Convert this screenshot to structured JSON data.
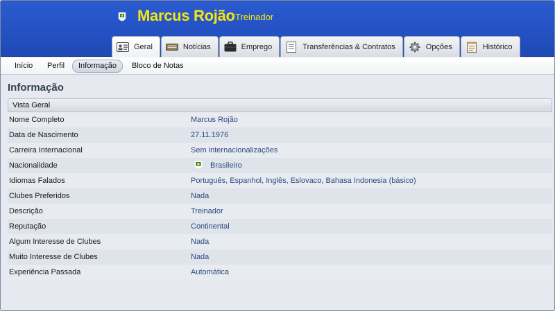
{
  "header": {
    "name": "Marcus Rojão",
    "role": "Treinador"
  },
  "tabs": [
    {
      "label": "Geral",
      "icon": "id-card-icon",
      "active": true
    },
    {
      "label": "Notícias",
      "icon": "newspaper-icon",
      "active": false
    },
    {
      "label": "Emprego",
      "icon": "briefcase-icon",
      "active": false
    },
    {
      "label": "Transferências & Contratos",
      "icon": "document-icon",
      "active": false
    },
    {
      "label": "Opções",
      "icon": "gear-icon",
      "active": false
    },
    {
      "label": "Histórico",
      "icon": "notepad-icon",
      "active": false
    }
  ],
  "subnav": [
    {
      "label": "Início",
      "active": false
    },
    {
      "label": "Perfil",
      "active": false
    },
    {
      "label": "Informação",
      "active": true
    },
    {
      "label": "Bloco de Notas",
      "active": false
    }
  ],
  "section": {
    "title": "Informação",
    "panel_title": "Vista Geral"
  },
  "info": [
    {
      "key": "Nome Completo",
      "value": "Marcus Rojão"
    },
    {
      "key": "Data de Nascimento",
      "value": "27.11.1976"
    },
    {
      "key": "Carreira Internacional",
      "value": "Sem internacionalizações"
    },
    {
      "key": "Nacionalidade",
      "value": "Brasileiro",
      "icon": "brazil-crest-icon"
    },
    {
      "key": "Idiomas Falados",
      "value": "Português, Espanhol, Inglês, Eslovaco, Bahasa Indonesia (básico)"
    },
    {
      "key": "Clubes Preferidos",
      "value": "Nada"
    },
    {
      "key": "Descrição",
      "value": "Treinador"
    },
    {
      "key": "Reputação",
      "value": "Continental"
    },
    {
      "key": "Algum Interesse de Clubes",
      "value": "Nada"
    },
    {
      "key": "Muito Interesse de Clubes",
      "value": "Nada"
    },
    {
      "key": "Experiência Passada",
      "value": "Automática"
    }
  ],
  "colors": {
    "header_blue": "#2452c4",
    "title_yellow": "#f6e60f",
    "value_blue": "#2b4a82"
  }
}
